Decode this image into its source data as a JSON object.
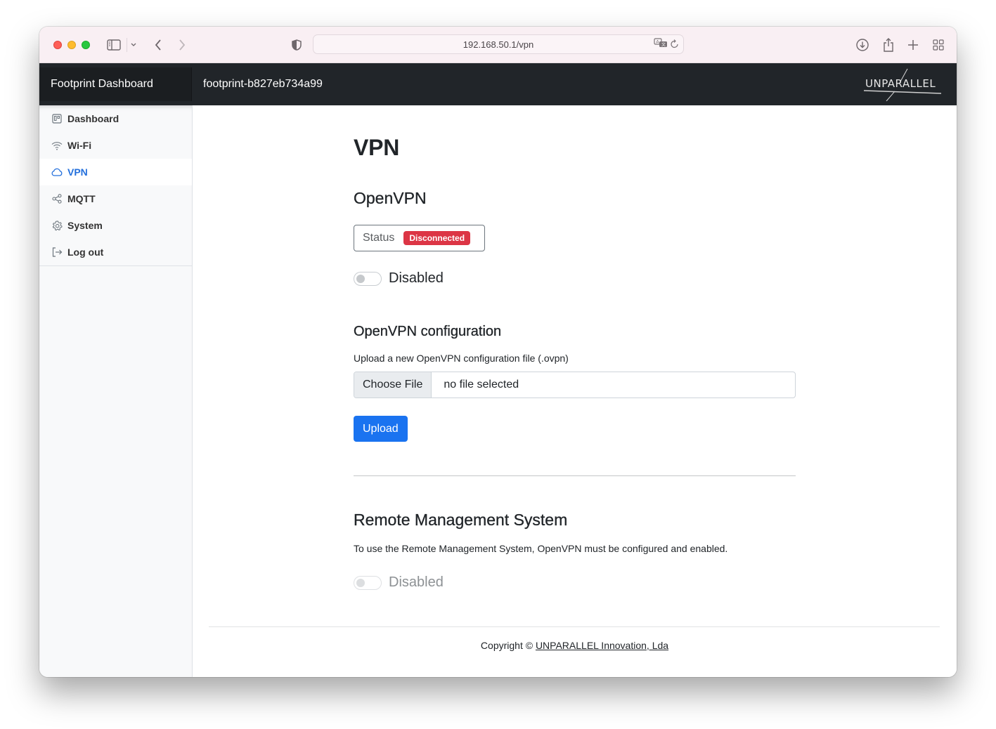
{
  "browser": {
    "url": "192.168.50.1/vpn",
    "icons": [
      "sidebar-toggle-icon",
      "chevron-down-icon",
      "back-icon",
      "forward-icon",
      "privacy-shield-icon",
      "translate-icon",
      "reload-icon",
      "download-icon",
      "share-icon",
      "new-tab-icon",
      "tab-overview-icon"
    ]
  },
  "navbar": {
    "brand": "Footprint Dashboard",
    "hostname": "footprint-b827eb734a99",
    "logo_text": "UNPARALLEL"
  },
  "sidebar": {
    "items": [
      {
        "label": "Dashboard",
        "icon": "dashboard-icon",
        "active": false
      },
      {
        "label": "Wi-Fi",
        "icon": "wifi-icon",
        "active": false
      },
      {
        "label": "VPN",
        "icon": "cloud-icon",
        "active": true
      },
      {
        "label": "MQTT",
        "icon": "share-nodes-icon",
        "active": false
      },
      {
        "label": "System",
        "icon": "gear-icon",
        "active": false
      },
      {
        "label": "Log out",
        "icon": "logout-icon",
        "active": false
      }
    ]
  },
  "main": {
    "title": "VPN",
    "openvpn": {
      "heading": "OpenVPN",
      "status_label": "Status",
      "status_value": "Disconnected",
      "status_color": "#dc3545",
      "toggle_label": "Disabled",
      "toggle_on": false
    },
    "config": {
      "heading": "OpenVPN configuration",
      "file_label": "Upload a new OpenVPN configuration file (.ovpn)",
      "choose_file": "Choose File",
      "file_status": "no file selected",
      "upload_button": "Upload",
      "accent_color": "#1a73f0"
    },
    "rms": {
      "heading": "Remote Management System",
      "help_text": "To use the Remote Management System, OpenVPN must be configured and enabled.",
      "toggle_label": "Disabled",
      "toggle_on": false,
      "toggle_disabled": true
    }
  },
  "footer": {
    "prefix": "Copyright © ",
    "link_text": "UNPARALLEL Innovation, Lda"
  }
}
